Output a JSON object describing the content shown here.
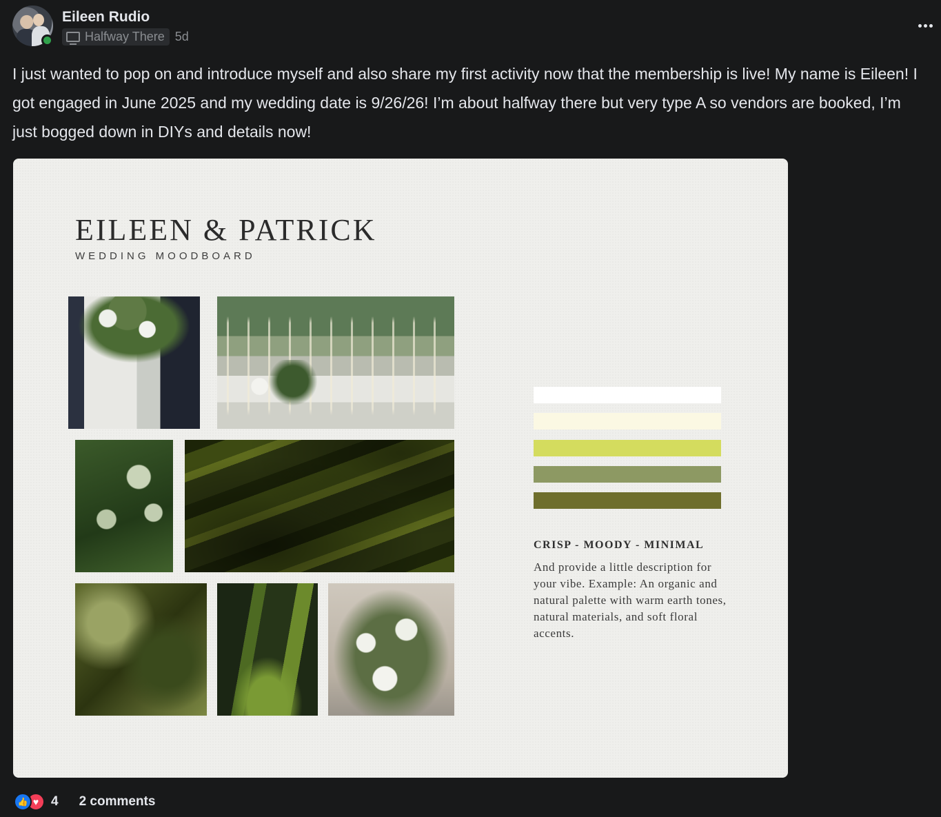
{
  "post": {
    "author": "Eileen Rudio",
    "badge": "Halfway There",
    "time": "5d",
    "text": "I just wanted to pop on and introduce myself and also share my first activity now that the membership is live! My name is Eileen! I got engaged in June 2025 and my wedding date is 9/26/26! I’m about halfway there but very type A so vendors are booked, I’m just bogged down in DIYs and details now!"
  },
  "moodboard": {
    "title": "EILEEN & PATRICK",
    "subtitle": "WEDDING MOODBOARD",
    "palette": [
      "#ffffff",
      "#fbf8e3",
      "#d4dc5e",
      "#8d9963",
      "#6e6e2c"
    ],
    "tagline": "CRISP - MOODY - MINIMAL",
    "description": "And provide a little description for your vibe. Example: An organic and natural palette with warm earth tones, natural materials, and soft floral accents."
  },
  "footer": {
    "reaction_count": "4",
    "comments": "2 comments"
  },
  "icons": {
    "badge": "monitor-icon",
    "reactions": [
      "like-icon",
      "heart-icon"
    ],
    "more": "more-options-icon"
  }
}
